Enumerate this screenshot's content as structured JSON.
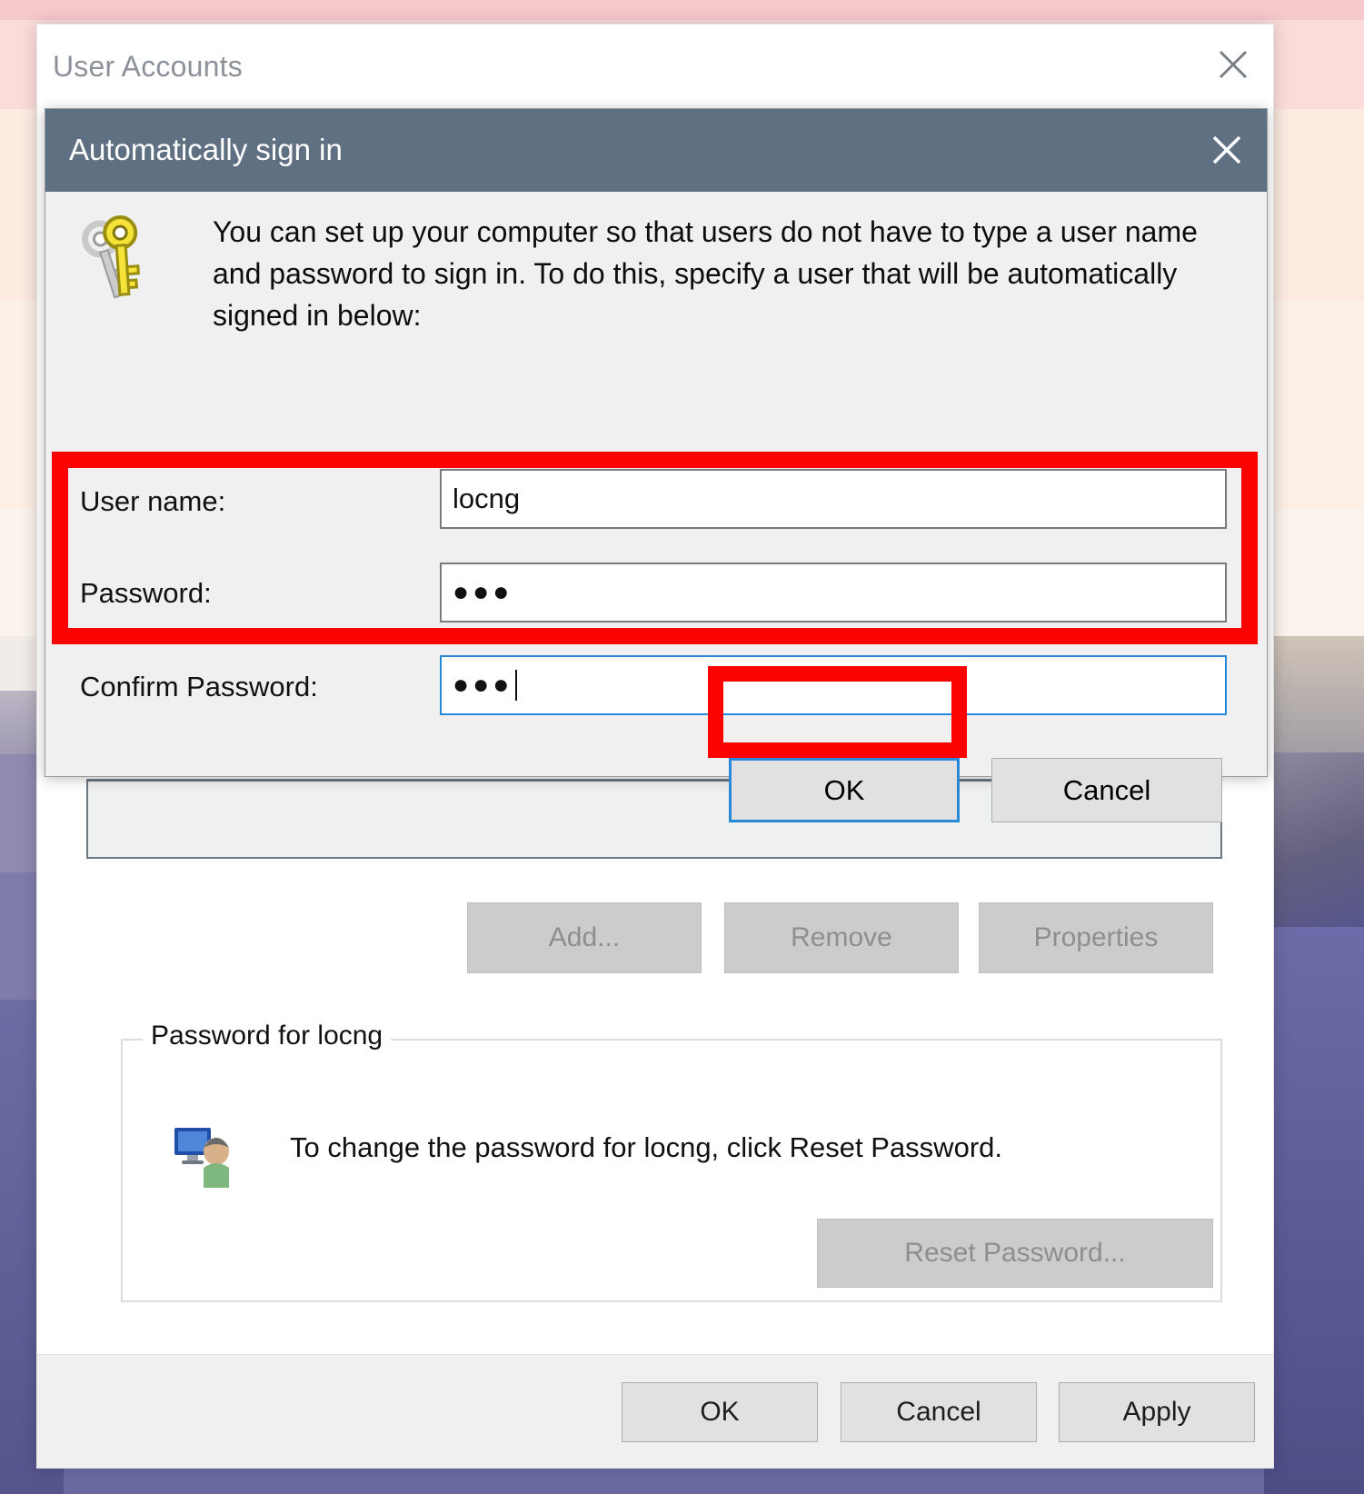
{
  "desktop": {
    "wallpaper_description": "blurred outdoor landscape wallpaper"
  },
  "outer_window": {
    "title": "User Accounts",
    "close_icon": "close-icon",
    "list_buttons": [
      {
        "label": "Add...",
        "disabled": true
      },
      {
        "label": "Remove",
        "disabled": true
      },
      {
        "label": "Properties",
        "disabled": true
      }
    ],
    "password_group": {
      "legend": "Password for locng",
      "icon": "user-account-icon",
      "description": "To change the password for locng, click Reset Password.",
      "reset_button": {
        "label": "Reset Password...",
        "disabled": true
      }
    },
    "footer_buttons": [
      {
        "label": "OK"
      },
      {
        "label": "Cancel"
      },
      {
        "label": "Apply"
      }
    ]
  },
  "modal": {
    "title": "Automatically sign in",
    "close_icon": "close-icon",
    "icon": "key-icon",
    "intro_text": "You can set up your computer so that users do not have to type a user name and password to sign in. To do this, specify a user that will be automatically signed in below:",
    "fields": [
      {
        "label": "User name:",
        "value": "locng",
        "masked": false,
        "focused": false
      },
      {
        "label": "Password:",
        "value": "●●●",
        "masked": true,
        "focused": false
      },
      {
        "label": "Confirm Password:",
        "value": "●●●",
        "masked": true,
        "focused": true
      }
    ],
    "buttons": {
      "ok": "OK",
      "cancel": "Cancel"
    }
  },
  "annotations": {
    "color": "#fb0303",
    "boxes": [
      {
        "target": "password-and-confirm-password-fields"
      },
      {
        "target": "ok-button"
      }
    ]
  }
}
